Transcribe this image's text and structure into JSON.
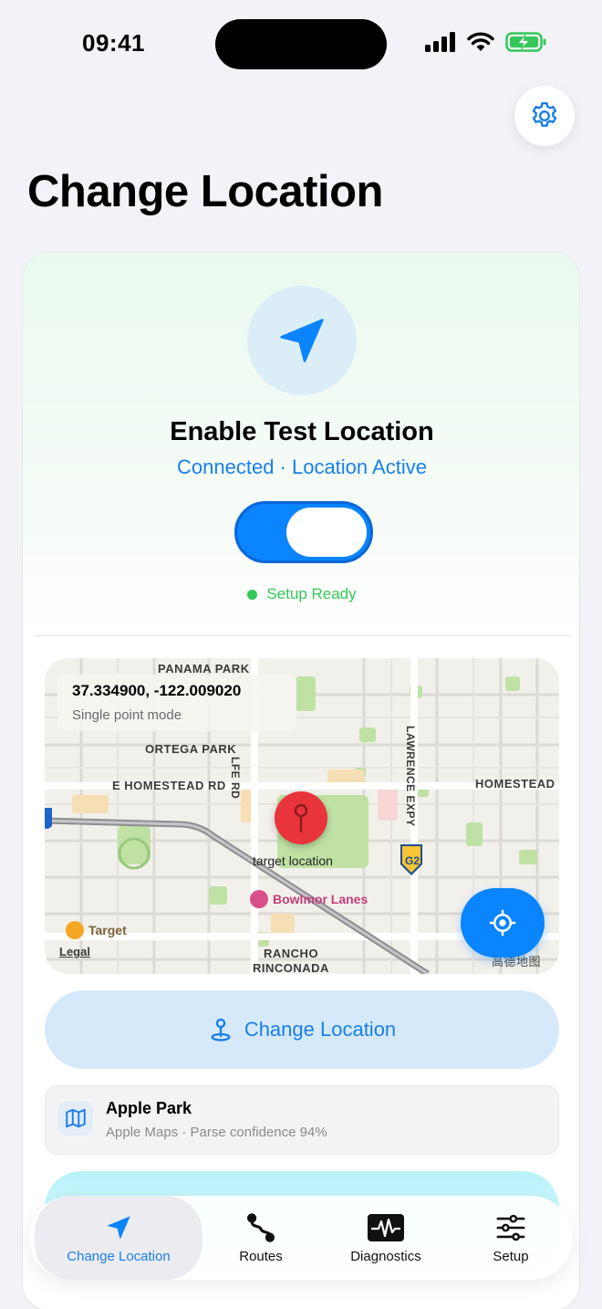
{
  "status_bar": {
    "time": "09:41"
  },
  "page": {
    "title": "Change Location"
  },
  "test_location": {
    "title": "Enable Test Location",
    "status": "Connected · Location Active",
    "toggle_on": true,
    "setup_status": "Setup Ready"
  },
  "map": {
    "coordinates": "37.334900, -122.009020",
    "mode": "Single point mode",
    "labels": {
      "panama_park": "PANAMA PARK",
      "ortega_park": "ORTEGA PARK",
      "homestead_w": "E HOMESTEAD RD",
      "homestead_e": "HOMESTEAD",
      "wolfe_rd": "LFE RD",
      "lawrence_expy": "LAWRENCE EXPY",
      "target_location": "target location",
      "bowlmor": "Bowlmor Lanes",
      "target_store": "Target",
      "legal": "Legal",
      "rancho": "RANCHO",
      "rinconada": "RINCONADA",
      "g2": "G2",
      "attribution": "高德地图"
    }
  },
  "actions": {
    "change_location": "Change Location"
  },
  "place": {
    "name": "Apple Park",
    "source": "Apple Maps · Parse confidence 94%"
  },
  "tabs": [
    {
      "label": "Change Location",
      "icon": "location-arrow-icon",
      "active": true
    },
    {
      "label": "Routes",
      "icon": "route-icon",
      "active": false
    },
    {
      "label": "Diagnostics",
      "icon": "waveform-icon",
      "active": false
    },
    {
      "label": "Setup",
      "icon": "sliders-icon",
      "active": false
    }
  ],
  "colors": {
    "accent": "#0a84ff",
    "success": "#34c759",
    "pin": "#e8343a"
  }
}
